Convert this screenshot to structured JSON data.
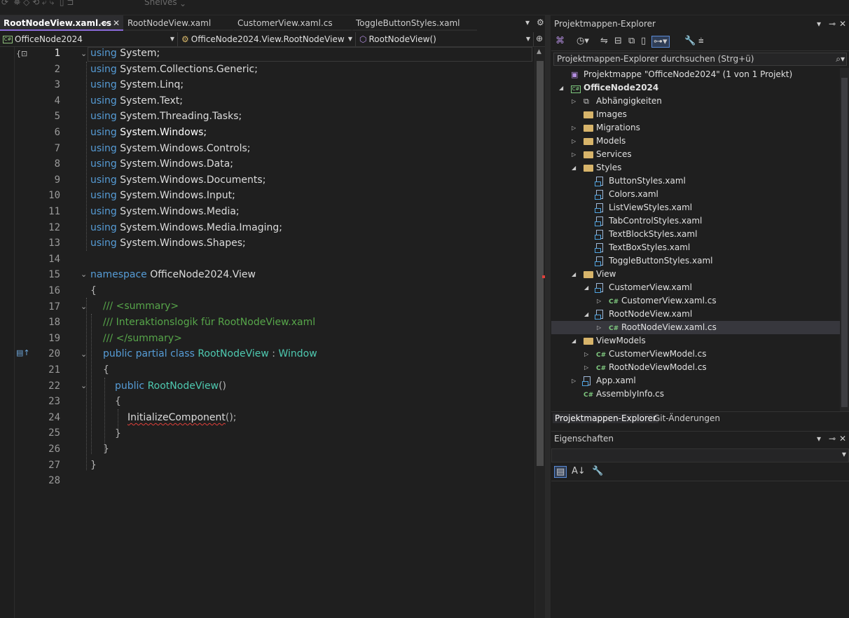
{
  "top_toolbar": {
    "partial_text": "Shelves"
  },
  "editor_tabs": [
    {
      "label": "RootNodeView.xaml.cs",
      "active": true
    },
    {
      "label": "RootNodeView.xaml",
      "active": false
    },
    {
      "label": "CustomerView.xaml.cs",
      "active": false
    },
    {
      "label": "ToggleButtonStyles.xaml",
      "active": false
    }
  ],
  "tab_pin_icon": "⊸",
  "tab_close_icon": "✕",
  "navbar": {
    "project": "OfficeNode2024",
    "class": "OfficeNode2024.View.RootNodeView",
    "member": "RootNodeView()"
  },
  "code": {
    "line_numbers": [
      "1",
      "2",
      "3",
      "4",
      "5",
      "6",
      "7",
      "8",
      "9",
      "10",
      "11",
      "12",
      "13",
      "14",
      "15",
      "16",
      "17",
      "18",
      "19",
      "20",
      "21",
      "22",
      "23",
      "24",
      "25",
      "26",
      "27",
      "28"
    ],
    "kw_using": "using",
    "usings": [
      "System;",
      "System.Collections.Generic;",
      "System.Linq;",
      "System.Text;",
      "System.Threading.Tasks;",
      "System.Windows;",
      "System.Windows.Controls;",
      "System.Windows.Data;",
      "System.Windows.Documents;",
      "System.Windows.Input;",
      "System.Windows.Media;",
      "System.Windows.Media.Imaging;",
      "System.Windows.Shapes;"
    ],
    "kw_namespace": "namespace",
    "namespace_name": "OfficeNode2024.View",
    "open_brace": "{",
    "close_brace": "}",
    "doc_summary_open": "/// <summary>",
    "doc_text": "/// Interaktionslogik für RootNodeView.xaml",
    "doc_summary_close": "/// </summary>",
    "kw_public": "public",
    "kw_partial": "partial",
    "kw_class": "class",
    "class_name": "RootNodeView",
    "colon": ":",
    "base_class": "Window",
    "ctor_name": "RootNodeView",
    "ctor_parens": "()",
    "call_name": "InitializeComponent",
    "call_tail": "();"
  },
  "solution_explorer": {
    "title": "Projektmappen-Explorer",
    "search_placeholder": "Projektmappen-Explorer durchsuchen (Strg+ü)",
    "solution": "Projektmappe \"OfficeNode2024\" (1 von 1 Projekt)",
    "project": "OfficeNode2024",
    "items": [
      "Abhängigkeiten",
      "Images",
      "Migrations",
      "Models",
      "Services",
      "Styles",
      "ButtonStyles.xaml",
      "Colors.xaml",
      "ListViewStyles.xaml",
      "TabControlStyles.xaml",
      "TextBlockStyles.xaml",
      "TextBoxStyles.xaml",
      "ToggleButtonStyles.xaml",
      "View",
      "CustomerView.xaml",
      "CustomerView.xaml.cs",
      "RootNodeView.xaml",
      "RootNodeView.xaml.cs",
      "ViewModels",
      "CustomerViewModel.cs",
      "RootNodeViewModel.cs",
      "App.xaml",
      "AssemblyInfo.cs"
    ],
    "bottom_tabs": [
      "Projektmappen-Explorer",
      "Git-Änderungen"
    ]
  },
  "properties": {
    "title": "Eigenschaften"
  },
  "colors": {
    "keyword": "#569cd6",
    "type": "#4ec9b0",
    "comment": "#57a64a",
    "accent": "#8a6ad8"
  }
}
